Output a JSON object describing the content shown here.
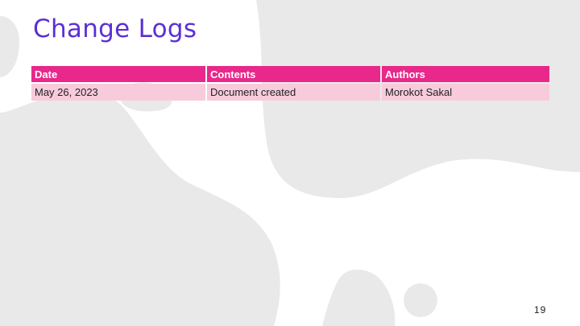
{
  "slide": {
    "title": "Change Logs",
    "page_number": "19"
  },
  "table": {
    "headers": [
      "Date",
      "Contents",
      "Authors"
    ],
    "rows": [
      [
        "May 26, 2023",
        "Document created",
        "Morokot Sakal"
      ]
    ]
  },
  "colors": {
    "title": "#5b2fd6",
    "header_bg": "#e8288a",
    "row_bg": "#f7cbdc",
    "background_gray": "#e9e9e9",
    "background_shape": "#ffffff"
  }
}
